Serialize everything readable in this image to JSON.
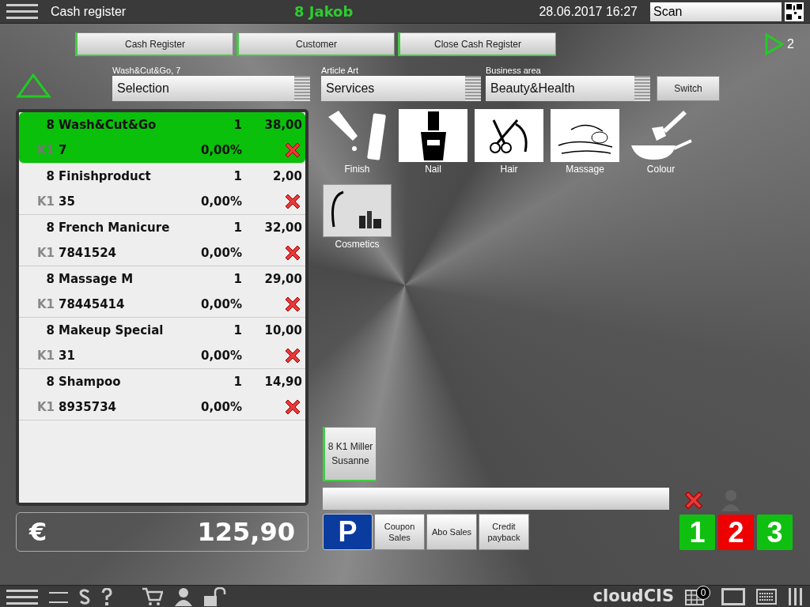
{
  "top_bar": {
    "title": "Cash register",
    "user": "8 Jakob",
    "datetime": "28.06.2017 16:27",
    "scan": {
      "placeholder": "Scan"
    }
  },
  "nav_tabs": [
    {
      "label": "Cash Register"
    },
    {
      "label": "Customer"
    },
    {
      "label": "Close Cash Register"
    }
  ],
  "page_counter": "2",
  "filters": [
    {
      "label": "Wash&Cut&Go, 7",
      "value": "Selection"
    },
    {
      "label": "Article Art",
      "value": "Services"
    },
    {
      "label": "Business area",
      "value": "Beauty&Health"
    }
  ],
  "switch_button": "Switch",
  "receipt": [
    {
      "group": "8",
      "name": "Wash&Cut&Go",
      "qty": "1",
      "price": "38,00",
      "cashier": "K1",
      "code": "7",
      "discount": "0,00%",
      "selected": true
    },
    {
      "group": "8",
      "name": "Finishproduct",
      "qty": "1",
      "price": "2,00",
      "cashier": "K1",
      "code": "35",
      "discount": "0,00%",
      "selected": false
    },
    {
      "group": "8",
      "name": "French Manicure",
      "qty": "1",
      "price": "32,00",
      "cashier": "K1",
      "code": "7841524",
      "discount": "0,00%",
      "selected": false
    },
    {
      "group": "8",
      "name": "Massage M",
      "qty": "1",
      "price": "29,00",
      "cashier": "K1",
      "code": "78445414",
      "discount": "0,00%",
      "selected": false
    },
    {
      "group": "8",
      "name": "Makeup Special",
      "qty": "1",
      "price": "10,00",
      "cashier": "K1",
      "code": "31",
      "discount": "0,00%",
      "selected": false
    },
    {
      "group": "8",
      "name": "Shampoo",
      "qty": "1",
      "price": "14,90",
      "cashier": "K1",
      "code": "8935734",
      "discount": "0,00%",
      "selected": false
    }
  ],
  "total": {
    "currency": "€",
    "amount": "125,90"
  },
  "categories": [
    {
      "label": "Finish",
      "kind": "bottle"
    },
    {
      "label": "Nail",
      "kind": "polish"
    },
    {
      "label": "Hair",
      "kind": "scissors"
    },
    {
      "label": "Massage",
      "kind": "spa"
    },
    {
      "label": "Colour",
      "kind": "brush"
    },
    {
      "label": "Cosmetics",
      "kind": "makeup"
    }
  ],
  "customer_button": "8 K1 Miller Susanne",
  "action_buttons": [
    {
      "label": "P",
      "kind": "parking"
    },
    {
      "label": "Coupon Sales",
      "kind": "plain"
    },
    {
      "label": "Abo Sales",
      "kind": "plain"
    },
    {
      "label": "Credit payback",
      "kind": "plain"
    }
  ],
  "registers": [
    {
      "label": "1",
      "color": "#10c010"
    },
    {
      "label": "2",
      "color": "#ee0000"
    },
    {
      "label": "3",
      "color": "#10c010"
    }
  ],
  "status_bar": {
    "brand": "cloudCIS",
    "calendar_badge": "0"
  }
}
